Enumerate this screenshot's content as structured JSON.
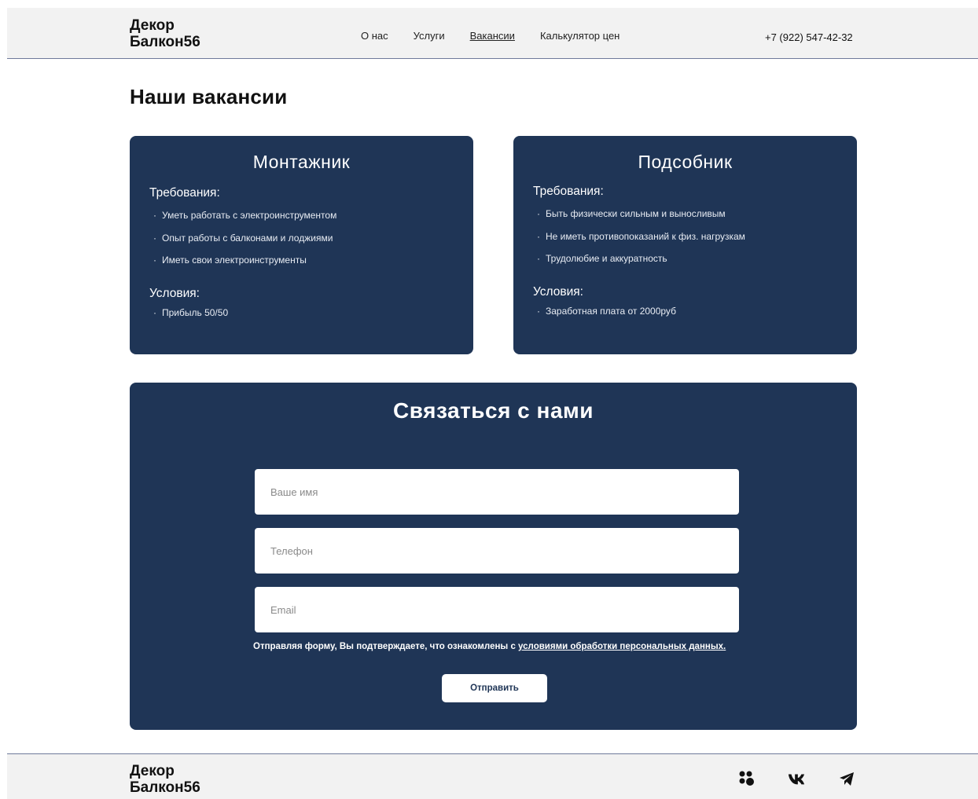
{
  "header": {
    "logo_line1": "Декор",
    "logo_line2": "Балкон56",
    "nav": [
      "О нас",
      "Услуги",
      "Вакансии",
      "Калькулятор цен"
    ],
    "phone": "+7 (922) 547-42-32"
  },
  "page_title": "Наши вакансии",
  "vacancies": [
    {
      "title": "Монтажник",
      "requirements_label": "Требования:",
      "requirements": [
        "Уметь работать с электроинструментом",
        "Опыт работы с балконами и лоджиями",
        "Иметь свои электроинструменты"
      ],
      "conditions_label": "Условия:",
      "conditions": [
        "Прибыль 50/50"
      ]
    },
    {
      "title": "Подсобник",
      "requirements_label": "Требования:",
      "requirements": [
        "Быть физически сильным и выносливым",
        "Не иметь противопоказаний к физ. нагрузкам",
        "Трудолюбие и аккуратность"
      ],
      "conditions_label": "Условия:",
      "conditions": [
        "Заработная плата от 2000руб"
      ]
    }
  ],
  "contact": {
    "title": "Связаться с нами",
    "name_placeholder": "Ваше имя",
    "phone_placeholder": "Телефон",
    "email_placeholder": "Email",
    "consent_text": "Отправляя форму, Вы подтверждаете,  что ознакомлены с ",
    "consent_link": "условиями обработки персональных данных.",
    "submit_label": "Отправить"
  },
  "footer": {
    "logo_line1": "Декор",
    "logo_line2": "Балкон56",
    "social_icons": [
      "four-dots-icon",
      "vk-icon",
      "telegram-icon"
    ]
  },
  "colors": {
    "card_bg": "#1f3556",
    "header_bg": "#f2f2f2"
  }
}
